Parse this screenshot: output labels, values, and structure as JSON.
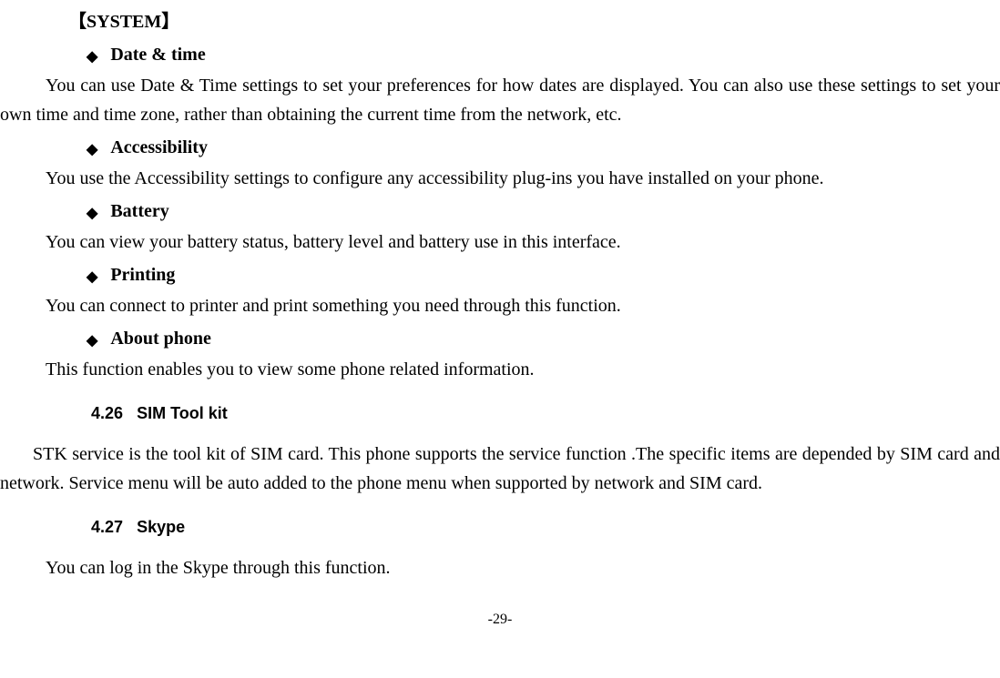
{
  "section_header": "【SYSTEM】",
  "items": [
    {
      "title": "Date & time",
      "body": "You can use Date & Time settings to set your preferences for how dates are displayed. You can also use these settings to set your own time and time zone, rather than obtaining the current time from the network, etc."
    },
    {
      "title": "Accessibility",
      "body": "You use the Accessibility settings to configure any accessibility plug-ins you have installed on your phone."
    },
    {
      "title": "Battery",
      "body": "You can view your battery status, battery level and battery use in this interface."
    },
    {
      "title": "Printing",
      "body": "You can connect to printer and print something you need through this function."
    },
    {
      "title": "About phone",
      "body": "This function enables you to view some phone related information."
    }
  ],
  "numbered": [
    {
      "num": "4.26",
      "title": "SIM Tool kit",
      "body": "STK service is the tool kit of SIM card. This phone supports the service function .The specific items are depended by SIM card and network. Service menu will be auto added to the phone menu when supported by network and SIM card.",
      "indent": true
    },
    {
      "num": "4.27",
      "title": "Skype",
      "body": "You can log in the Skype through this function.",
      "indent": false
    }
  ],
  "page_number": "-29-"
}
